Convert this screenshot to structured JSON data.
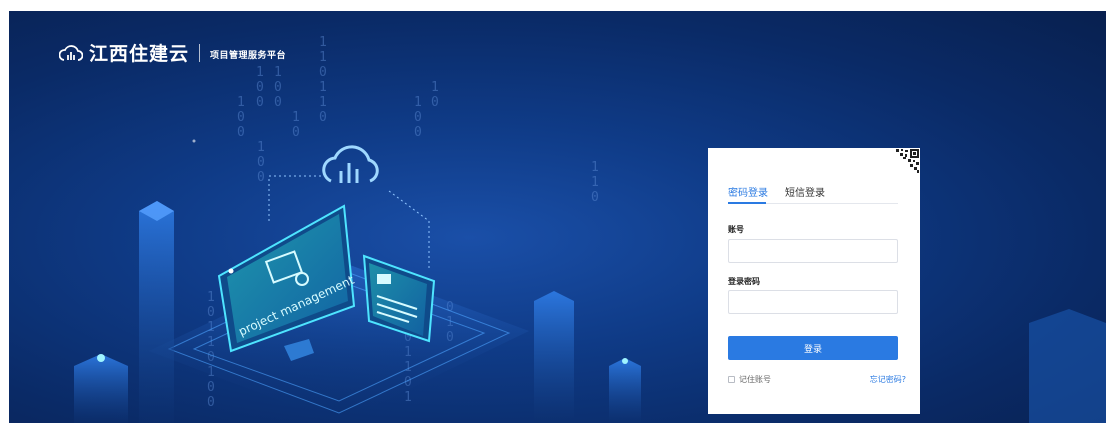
{
  "header": {
    "logo_icon": "cloud-bars-icon",
    "title": "江西住建云",
    "subtitle": "项目管理服务平台"
  },
  "hero": {
    "monitor_text": "project management",
    "cloud_icon": "cloud-chart-icon",
    "binary_strings": [
      "1",
      "1",
      "0",
      "1",
      "1",
      "0",
      "0",
      "1",
      "0",
      "1",
      "0",
      "1"
    ]
  },
  "login": {
    "qr_icon": "qr-code-icon",
    "tabs": [
      {
        "label": "密码登录",
        "active": true
      },
      {
        "label": "短信登录",
        "active": false
      }
    ],
    "account_label": "账号",
    "account_value": "",
    "account_placeholder": "",
    "password_label": "登录密码",
    "password_value": "",
    "password_placeholder": "",
    "submit_label": "登录",
    "remember_label": "记住账号",
    "remember_checked": false,
    "forgot_label": "忘记密码?"
  },
  "colors": {
    "accent": "#2a7ae2",
    "background_dark": "#0a2a66",
    "background_light": "#1a4fa8"
  }
}
